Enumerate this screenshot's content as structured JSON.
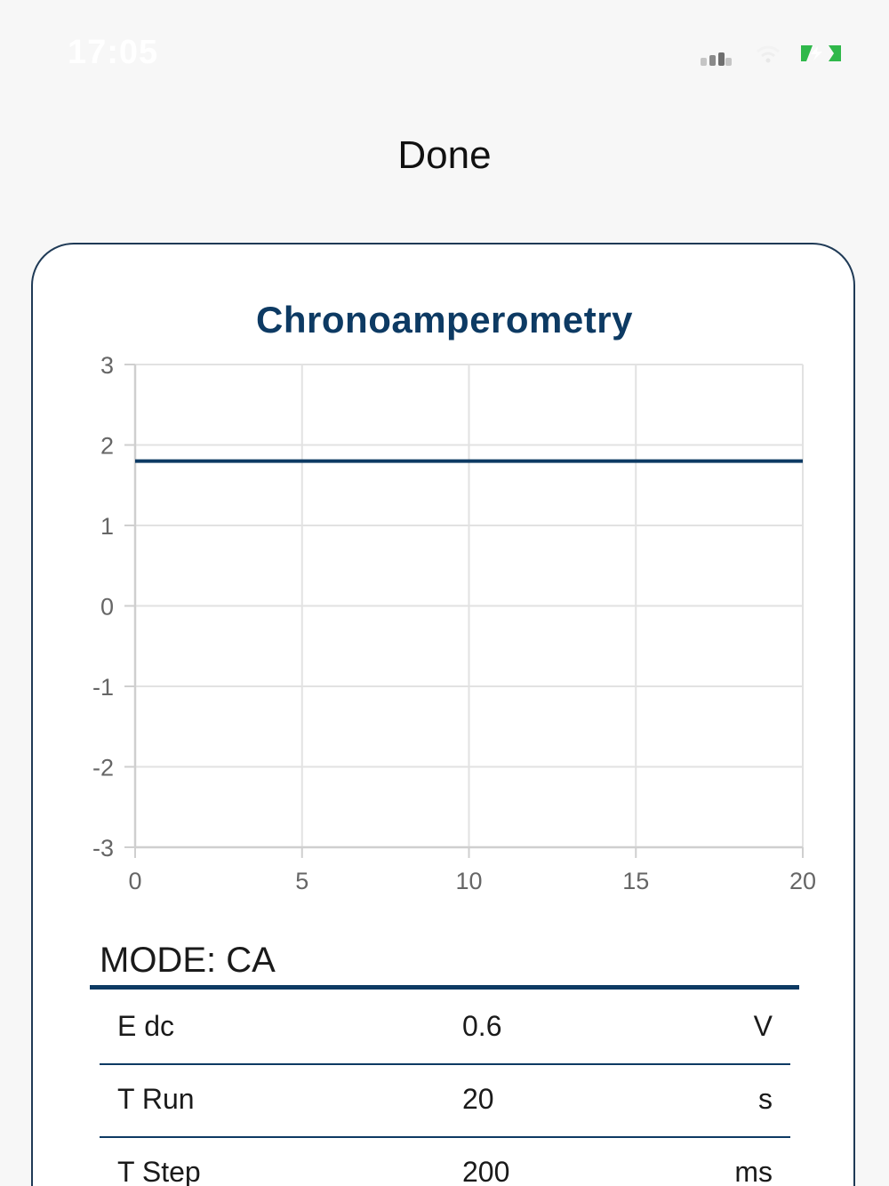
{
  "status_bar": {
    "time": "17:05",
    "signal_icon": "cellular-signal-icon",
    "wifi_icon": "wifi-icon",
    "battery_icon": "battery-charging-icon",
    "battery_color": "#2fb84a"
  },
  "header": {
    "title": "Done"
  },
  "chart_data": {
    "type": "line",
    "title": "Chronoamperometry",
    "xlabel": "",
    "ylabel": "",
    "xlim": [
      0,
      20
    ],
    "ylim": [
      -3,
      3
    ],
    "x_ticks": [
      "0",
      "5",
      "10",
      "15",
      "20"
    ],
    "y_ticks": [
      "3",
      "2",
      "1",
      "0",
      "-1",
      "-2",
      "-3"
    ],
    "grid": true,
    "series": [
      {
        "x": [
          0,
          2,
          4,
          6,
          8,
          10,
          12,
          14,
          16,
          18,
          20
        ],
        "y": [
          1.8,
          1.8,
          1.8,
          1.8,
          1.8,
          1.8,
          1.8,
          1.8,
          1.8,
          1.8,
          1.8
        ],
        "color": "#0d3a63"
      }
    ]
  },
  "mode": {
    "label": "MODE: CA"
  },
  "params": [
    {
      "name": "E dc",
      "value": "0.6",
      "unit": "V"
    },
    {
      "name": "T Run",
      "value": "20",
      "unit": "s"
    },
    {
      "name": "T Step",
      "value": "200",
      "unit": "ms"
    }
  ],
  "colors": {
    "accent": "#0d3a63",
    "card_border": "#1f3a56",
    "grid": "#e2e2e2",
    "background": "#f7f7f7"
  }
}
